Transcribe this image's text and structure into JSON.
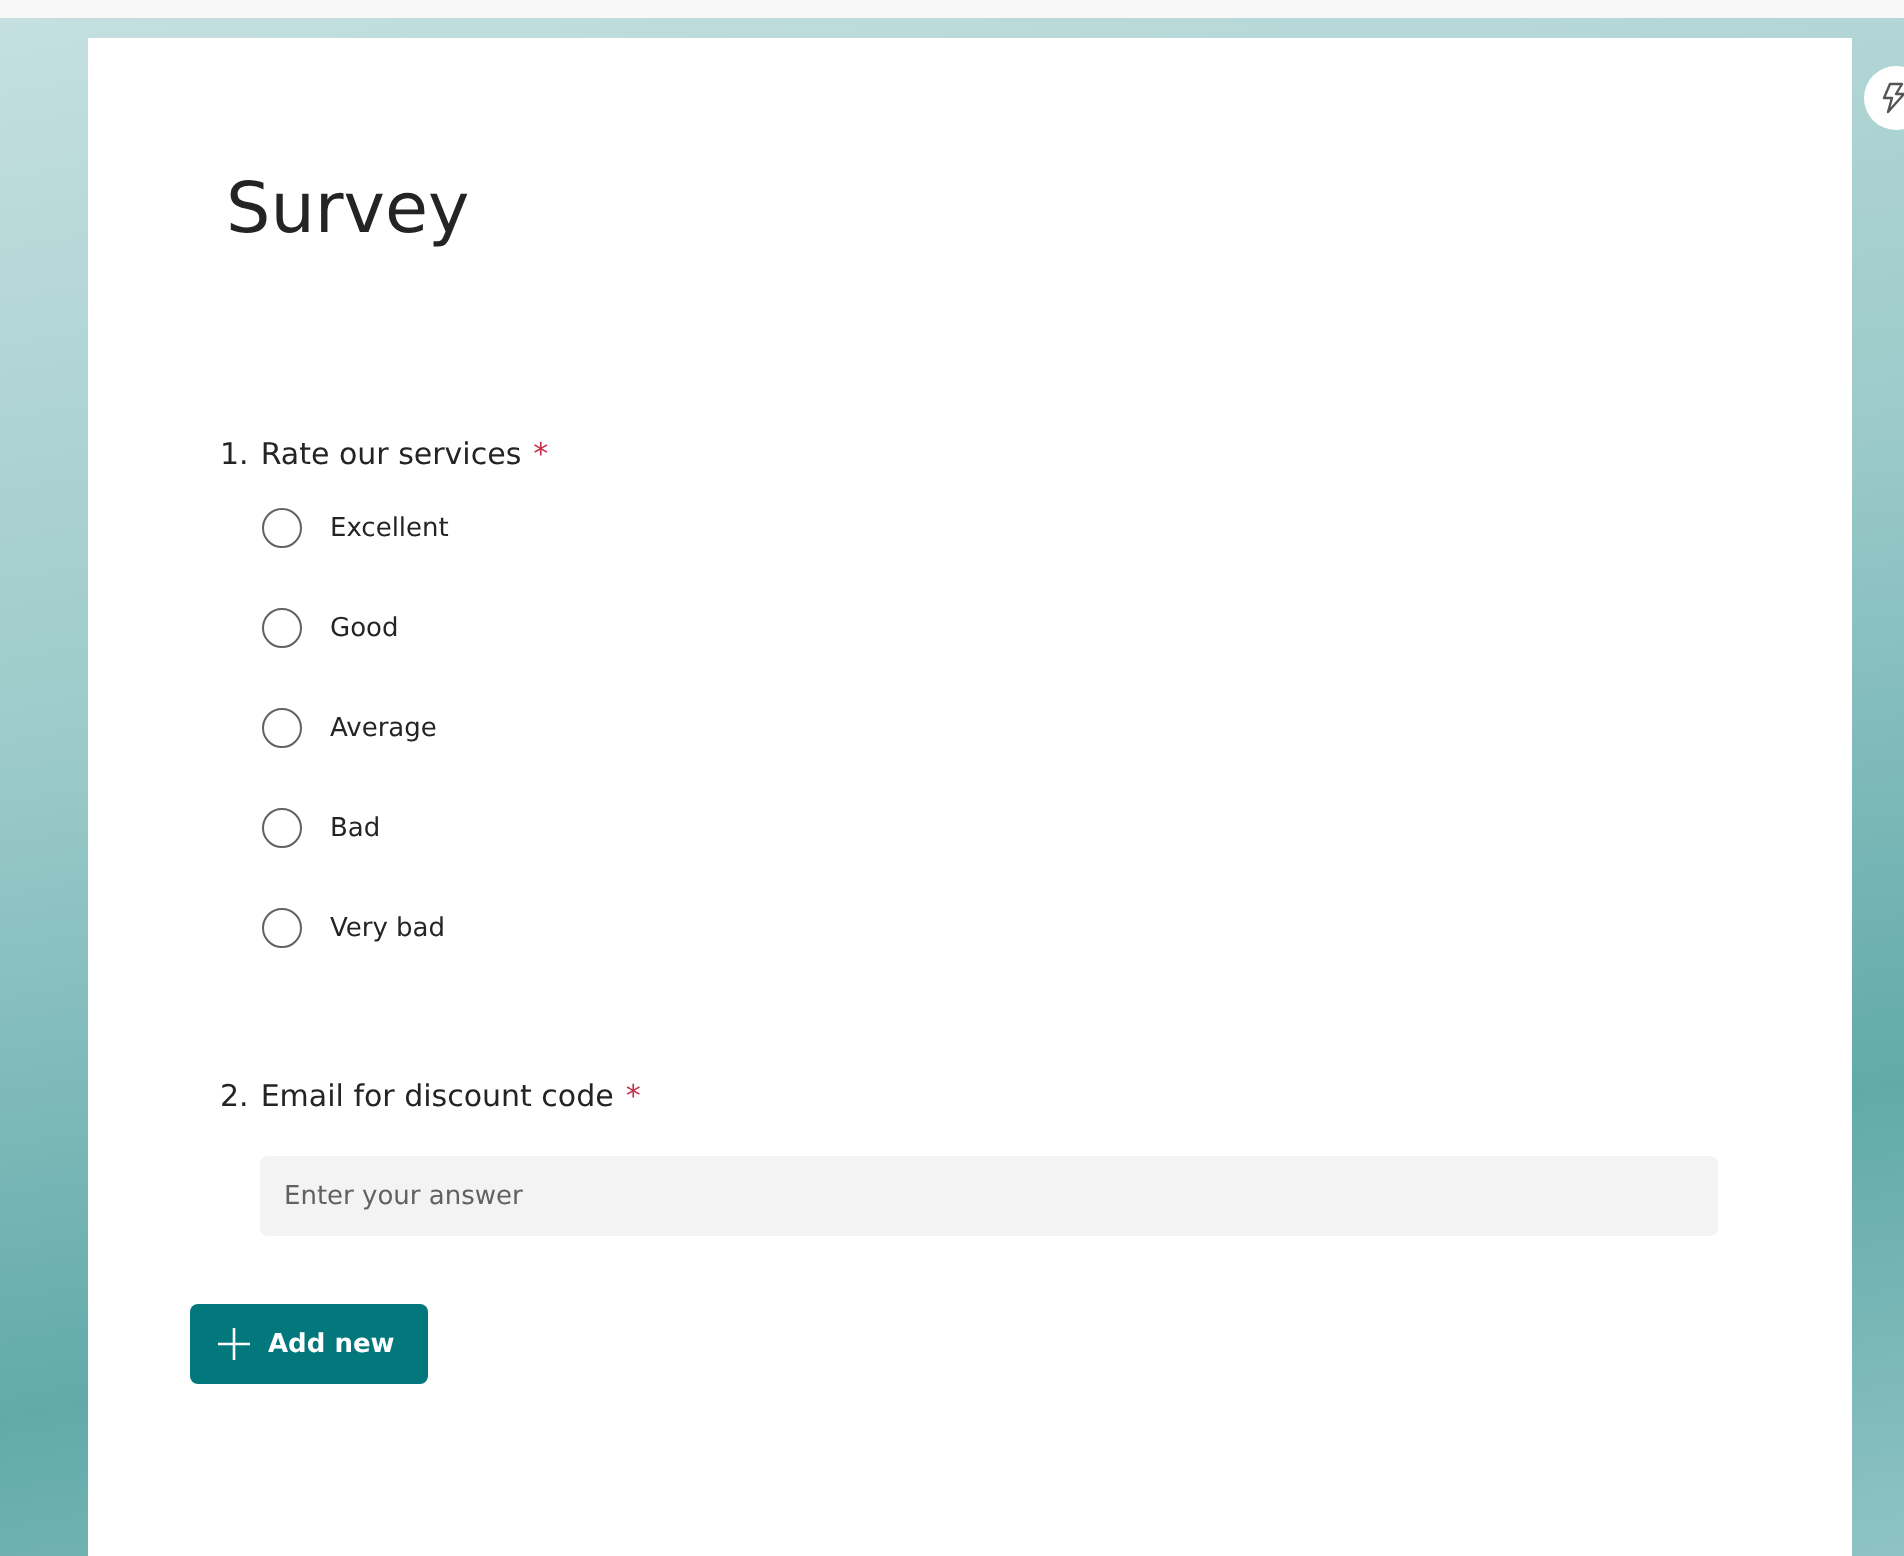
{
  "form": {
    "title": "Survey",
    "questions": [
      {
        "kind": "choice",
        "number": "1.",
        "text": "Rate our services",
        "required_mark": "*",
        "options": [
          {
            "label": "Excellent",
            "selected": false
          },
          {
            "label": "Good",
            "selected": false
          },
          {
            "label": "Average",
            "selected": false
          },
          {
            "label": "Bad",
            "selected": false
          },
          {
            "label": "Very bad",
            "selected": false
          }
        ]
      },
      {
        "kind": "text",
        "number": "2.",
        "text": "Email for discount code",
        "required_mark": "*",
        "placeholder": "Enter your answer"
      }
    ],
    "add_button": {
      "label": "Add new"
    }
  }
}
